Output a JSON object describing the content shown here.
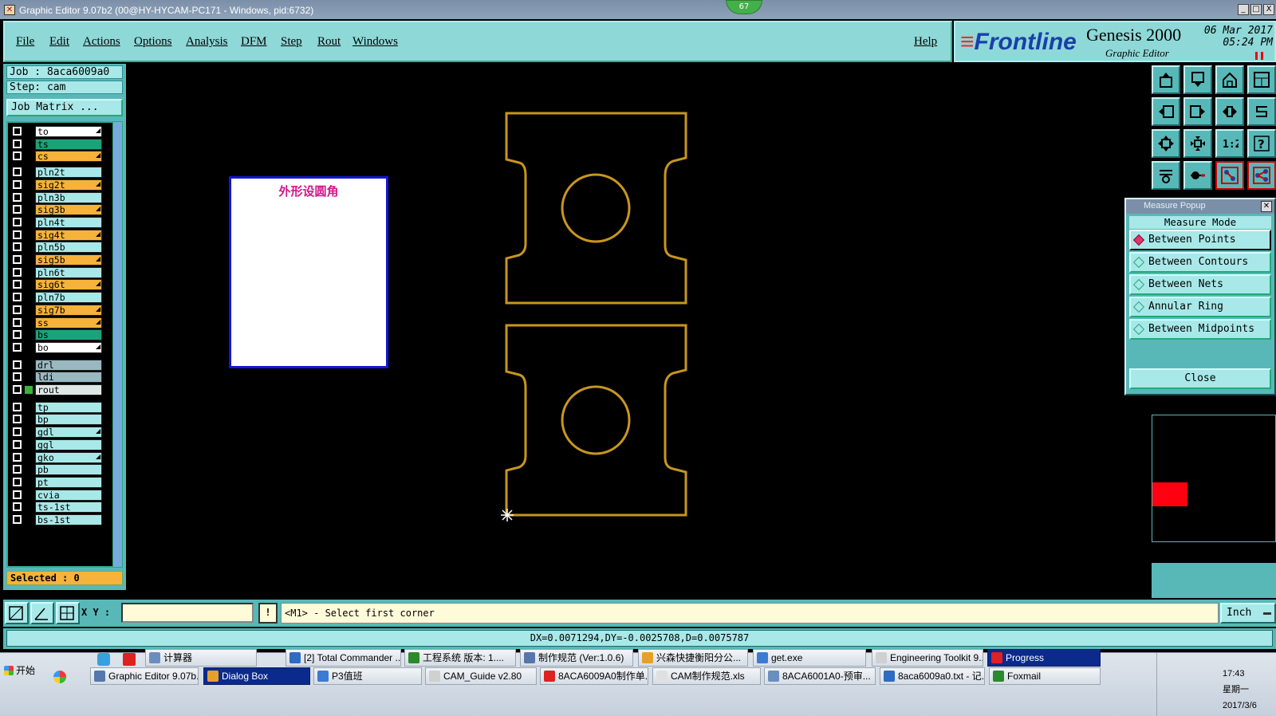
{
  "window": {
    "title": "Graphic Editor 9.07b2 (00@HY-HYCAM-PC171 - Windows, pid:6732)",
    "badge": "67",
    "minimize": "_",
    "maximize": "□",
    "close": "X"
  },
  "menu": {
    "items": [
      "File",
      "Edit",
      "Actions",
      "Options",
      "Analysis",
      "DFM",
      "Step",
      "Rout",
      "Windows"
    ],
    "help": "Help"
  },
  "brand": {
    "logo": "Frontline",
    "product": "Genesis 2000",
    "subtitle": "Graphic Editor",
    "date": "06 Mar 2017",
    "time": "05:24 PM"
  },
  "job": {
    "job_line": "Job : 8aca6009a0",
    "step_line": "Step: cam",
    "matrix_button": "Job Matrix ...",
    "selected": "Selected : 0"
  },
  "layers": [
    {
      "name": "to",
      "color": "#ffffff",
      "arrow": true
    },
    {
      "name": "ts",
      "color": "#1aa37a",
      "arrow": false
    },
    {
      "name": "cs",
      "color": "#f6b23a",
      "arrow": true
    },
    {
      "name": "pln2t",
      "color": "#a8e8e8",
      "arrow": false
    },
    {
      "name": "sig2t",
      "color": "#f6b23a",
      "arrow": true
    },
    {
      "name": "pln3b",
      "color": "#a8e8e8",
      "arrow": false
    },
    {
      "name": "sig3b",
      "color": "#f6b23a",
      "arrow": true
    },
    {
      "name": "pln4t",
      "color": "#a8e8e8",
      "arrow": false
    },
    {
      "name": "sig4t",
      "color": "#f6b23a",
      "arrow": true
    },
    {
      "name": "pln5b",
      "color": "#a8e8e8",
      "arrow": false
    },
    {
      "name": "sig5b",
      "color": "#f6b23a",
      "arrow": true
    },
    {
      "name": "pln6t",
      "color": "#a8e8e8",
      "arrow": false
    },
    {
      "name": "sig6t",
      "color": "#f6b23a",
      "arrow": true
    },
    {
      "name": "pln7b",
      "color": "#a8e8e8",
      "arrow": false
    },
    {
      "name": "sig7b",
      "color": "#f6b23a",
      "arrow": true
    },
    {
      "name": "ss",
      "color": "#f6b23a",
      "arrow": true
    },
    {
      "name": "bs",
      "color": "#1aa37a",
      "arrow": false
    },
    {
      "name": "bo",
      "color": "#ffffff",
      "arrow": true
    },
    {
      "name": "drl",
      "color": "#9ab8c0",
      "arrow": false
    },
    {
      "name": "ldi",
      "color": "#9ab8c0",
      "arrow": false
    },
    {
      "name": "rout",
      "color": "#dfe6e6",
      "arrow": false
    },
    {
      "name": "tp",
      "color": "#a8e8e8",
      "arrow": false
    },
    {
      "name": "bp",
      "color": "#a8e8e8",
      "arrow": false
    },
    {
      "name": "gdl",
      "color": "#a8e8e8",
      "arrow": true
    },
    {
      "name": "ggl",
      "color": "#a8e8e8",
      "arrow": false
    },
    {
      "name": "gko",
      "color": "#a8e8e8",
      "arrow": true
    },
    {
      "name": "pb",
      "color": "#a8e8e8",
      "arrow": false
    },
    {
      "name": "pt",
      "color": "#a8e8e8",
      "arrow": false
    },
    {
      "name": "cvia",
      "color": "#a8e8e8",
      "arrow": false
    },
    {
      "name": "ts-1st",
      "color": "#a8e8e8",
      "arrow": false
    },
    {
      "name": "bs-1st",
      "color": "#a8e8e8",
      "arrow": false
    }
  ],
  "canvas": {
    "note_text": "外形设圆角",
    "outline_color": "#c8961e"
  },
  "measure": {
    "title": "Measure Popup",
    "mode_label": "Measure Mode",
    "options": [
      "Between Points",
      "Between Contours",
      "Between Nets",
      "Annular Ring",
      "Between Midpoints"
    ],
    "selected_index": 0,
    "close_label": "Close"
  },
  "command": {
    "xy_label": "X Y :",
    "xy_value": "",
    "warn": "!",
    "prompt": "<M1> - Select first corner",
    "unit": "Inch",
    "status": "DX=0.0071294,DY=-0.0025708,D=0.0075787"
  },
  "taskbar": {
    "start": "开始",
    "row1": [
      "计算器",
      "[2] Total Commander ...",
      "工程系统  版本: 1....",
      "制作规范 (Ver:1.0.6)",
      "兴森快捷衡阳分公...",
      "get.exe",
      "Engineering Toolkit 9....",
      "Progress"
    ],
    "row2": [
      "Graphic Editor 9.07b...",
      "Dialog Box",
      "P3值班",
      "CAM_Guide v2.80",
      "8ACA6009A0制作单...",
      "CAM制作规范.xls",
      "8ACA6001A0-预审...",
      "8aca6009a0.txt - 记...",
      "Foxmail"
    ],
    "clock_time": "17:43",
    "clock_day": "星期一",
    "clock_date": "2017/3/6"
  }
}
